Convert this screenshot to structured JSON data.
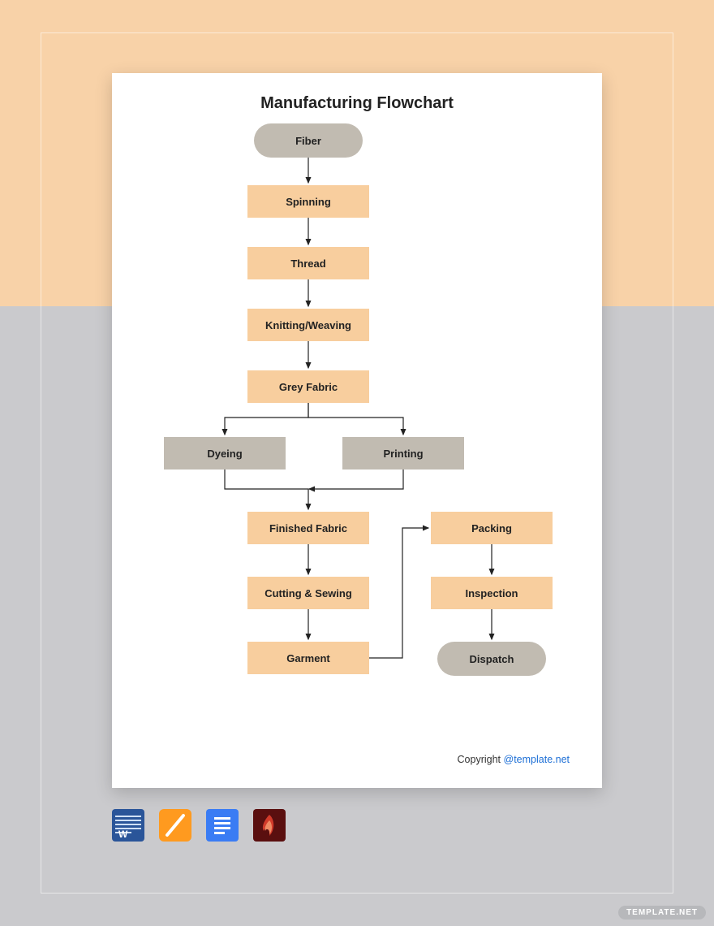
{
  "title": "Manufacturing Flowchart",
  "nodes": {
    "fiber": "Fiber",
    "spinning": "Spinning",
    "thread": "Thread",
    "knitting": "Knitting/Weaving",
    "grey_fabric": "Grey Fabric",
    "dyeing": "Dyeing",
    "printing": "Printing",
    "finished_fabric": "Finished Fabric",
    "cutting_sewing": "Cutting & Sewing",
    "garment": "Garment",
    "packing": "Packing",
    "inspection": "Inspection",
    "dispatch": "Dispatch"
  },
  "copyright_text": "Copyright ",
  "copyright_link": "@template.net",
  "icons": {
    "word": "word-icon",
    "pages": "pages-icon",
    "gdocs": "gdocs-icon",
    "pdf": "pdf-icon"
  },
  "watermark": "TEMPLATE.NET",
  "colors": {
    "peach": "#f8d2a8",
    "node_orange": "#f8ce9e",
    "node_grey": "#c1bbb1",
    "bg_grey": "#cacacd"
  }
}
